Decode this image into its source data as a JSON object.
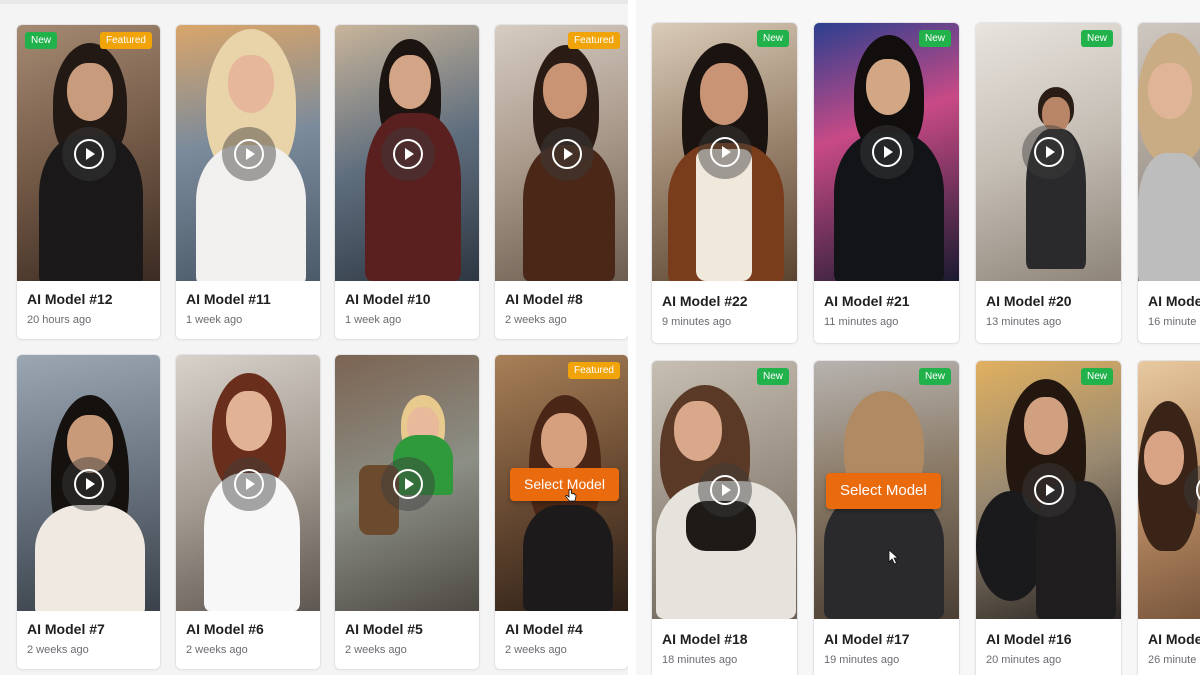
{
  "colors": {
    "new_badge": "#21b24b",
    "featured_badge": "#f0a40a",
    "select_button": "#ea6a0e"
  },
  "icons": {
    "play": "play-circle-icon",
    "cursor": "hand-pointer-cursor"
  },
  "left_grid": {
    "cards": [
      {
        "title": "AI Model #12",
        "time": "20 hours ago",
        "badges": [
          "New",
          "Featured"
        ]
      },
      {
        "title": "AI Model #11",
        "time": "1 week ago",
        "badges": []
      },
      {
        "title": "AI Model #10",
        "time": "1 week ago",
        "badges": []
      },
      {
        "title": "AI Model #8",
        "time": "2 weeks ago",
        "badges": [
          "Featured"
        ]
      },
      {
        "title": "AI Model #7",
        "time": "2 weeks ago",
        "badges": []
      },
      {
        "title": "AI Model #6",
        "time": "2 weeks ago",
        "badges": []
      },
      {
        "title": "AI Model #5",
        "time": "2 weeks ago",
        "badges": []
      },
      {
        "title": "AI Model #4",
        "time": "2 weeks ago",
        "badges": [
          "Featured"
        ],
        "hover_button": "Select Model"
      }
    ]
  },
  "right_grid": {
    "cards": [
      {
        "title": "AI Model #22",
        "time": "9 minutes ago",
        "badges": [
          "New"
        ]
      },
      {
        "title": "AI Model #21",
        "time": "11 minutes ago",
        "badges": [
          "New"
        ]
      },
      {
        "title": "AI Model #20",
        "time": "13 minutes ago",
        "badges": [
          "New"
        ]
      },
      {
        "title": "AI Mode",
        "time": "16 minute",
        "badges": []
      },
      {
        "title": "AI Model #18",
        "time": "18 minutes ago",
        "badges": [
          "New"
        ]
      },
      {
        "title": "AI Model #17",
        "time": "19 minutes ago",
        "badges": [
          "New"
        ],
        "hover_button": "Select Model"
      },
      {
        "title": "AI Model #16",
        "time": "20 minutes ago",
        "badges": [
          "New"
        ]
      },
      {
        "title": "AI Mode",
        "time": "26 minute",
        "badges": []
      }
    ]
  }
}
